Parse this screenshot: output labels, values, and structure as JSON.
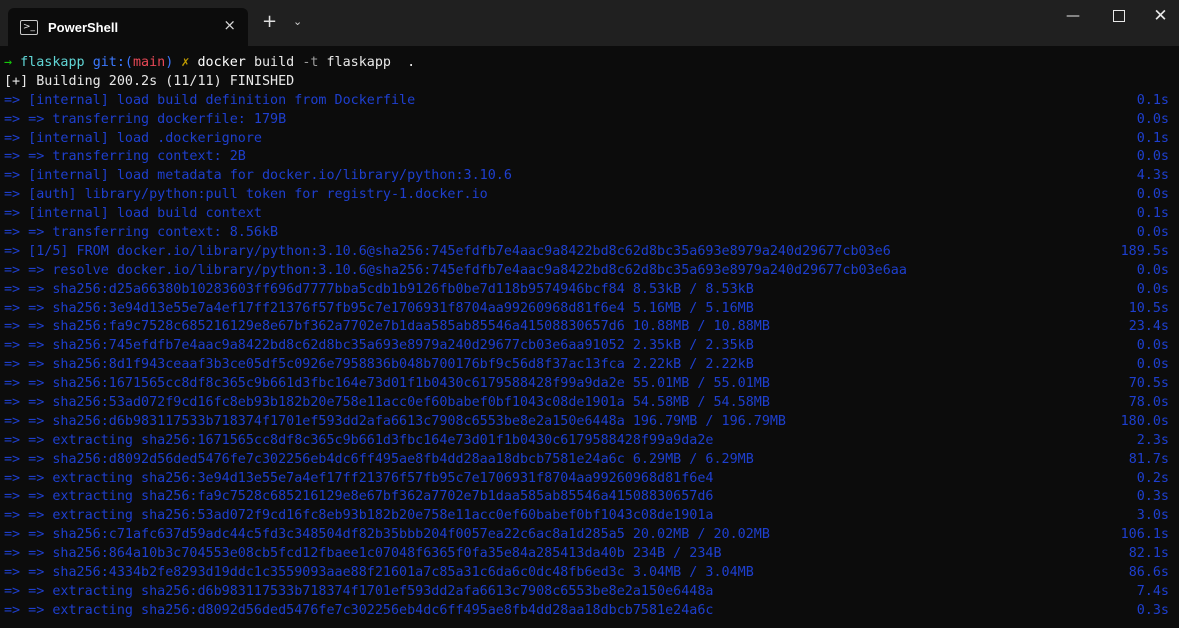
{
  "window": {
    "tab_title": "PowerShell",
    "tab_icon_glyph": ">_",
    "close_tab_glyph": "×",
    "new_tab_glyph": "+",
    "dropdown_glyph": "⌄",
    "minimize_glyph": "—",
    "close_glyph": "✕"
  },
  "prompt": {
    "arrow": "→",
    "dir": "flaskapp",
    "git_label": "git:(",
    "branch": "main",
    "git_close": ")",
    "dirty_mark": "✗",
    "command": "docker",
    "subcommand": "build",
    "flag": "-t",
    "args": "flaskapp  ."
  },
  "build_status": "[+] Building 200.2s (11/11) FINISHED",
  "colors": {
    "background": "#0c0c0c",
    "log_text": "#1e3fcf",
    "prompt_arrow": "#16c60c"
  },
  "log_lines": [
    {
      "text": "=> [internal] load build definition from Dockerfile",
      "time": "0.1s"
    },
    {
      "text": "=> => transferring dockerfile: 179B",
      "time": "0.0s"
    },
    {
      "text": "=> [internal] load .dockerignore",
      "time": "0.1s"
    },
    {
      "text": "=> => transferring context: 2B",
      "time": "0.0s"
    },
    {
      "text": "=> [internal] load metadata for docker.io/library/python:3.10.6",
      "time": "4.3s"
    },
    {
      "text": "=> [auth] library/python:pull token for registry-1.docker.io",
      "time": "0.0s"
    },
    {
      "text": "=> [internal] load build context",
      "time": "0.1s"
    },
    {
      "text": "=> => transferring context: 8.56kB",
      "time": "0.0s"
    },
    {
      "text": "=> [1/5] FROM docker.io/library/python:3.10.6@sha256:745efdfb7e4aac9a8422bd8c62d8bc35a693e8979a240d29677cb03e6",
      "time": "189.5s"
    },
    {
      "text": "=> => resolve docker.io/library/python:3.10.6@sha256:745efdfb7e4aac9a8422bd8c62d8bc35a693e8979a240d29677cb03e6aa",
      "time": "0.0s"
    },
    {
      "text": "=> => sha256:d25a66380b10283603ff696d7777bba5cdb1b9126fb0be7d118b9574946bcf84 8.53kB / 8.53kB",
      "time": "0.0s"
    },
    {
      "text": "=> => sha256:3e94d13e55e7a4ef17ff21376f57fb95c7e1706931f8704aa99260968d81f6e4 5.16MB / 5.16MB",
      "time": "10.5s"
    },
    {
      "text": "=> => sha256:fa9c7528c685216129e8e67bf362a7702e7b1daa585ab85546a41508830657d6 10.88MB / 10.88MB",
      "time": "23.4s"
    },
    {
      "text": "=> => sha256:745efdfb7e4aac9a8422bd8c62d8bc35a693e8979a240d29677cb03e6aa91052 2.35kB / 2.35kB",
      "time": "0.0s"
    },
    {
      "text": "=> => sha256:8d1f943ceaaf3b3ce05df5c0926e7958836b048b700176bf9c56d8f37ac13fca 2.22kB / 2.22kB",
      "time": "0.0s"
    },
    {
      "text": "=> => sha256:1671565cc8df8c365c9b661d3fbc164e73d01f1b0430c6179588428f99a9da2e 55.01MB / 55.01MB",
      "time": "70.5s"
    },
    {
      "text": "=> => sha256:53ad072f9cd16fc8eb93b182b20e758e11acc0ef60babef0bf1043c08de1901a 54.58MB / 54.58MB",
      "time": "78.0s"
    },
    {
      "text": "=> => sha256:d6b983117533b718374f1701ef593dd2afa6613c7908c6553be8e2a150e6448a 196.79MB / 196.79MB",
      "time": "180.0s"
    },
    {
      "text": "=> => extracting sha256:1671565cc8df8c365c9b661d3fbc164e73d01f1b0430c6179588428f99a9da2e",
      "time": "2.3s"
    },
    {
      "text": "=> => sha256:d8092d56ded5476fe7c302256eb4dc6ff495ae8fb4dd28aa18dbcb7581e24a6c 6.29MB / 6.29MB",
      "time": "81.7s"
    },
    {
      "text": "=> => extracting sha256:3e94d13e55e7a4ef17ff21376f57fb95c7e1706931f8704aa99260968d81f6e4",
      "time": "0.2s"
    },
    {
      "text": "=> => extracting sha256:fa9c7528c685216129e8e67bf362a7702e7b1daa585ab85546a41508830657d6",
      "time": "0.3s"
    },
    {
      "text": "=> => extracting sha256:53ad072f9cd16fc8eb93b182b20e758e11acc0ef60babef0bf1043c08de1901a",
      "time": "3.0s"
    },
    {
      "text": "=> => sha256:c71afc637d59adc44c5fd3c348504df82b35bbb204f0057ea22c6ac8a1d285a5 20.02MB / 20.02MB",
      "time": "106.1s"
    },
    {
      "text": "=> => sha256:864a10b3c704553e08cb5fcd12fbaee1c07048f6365f0fa35e84a285413da40b 234B / 234B",
      "time": "82.1s"
    },
    {
      "text": "=> => sha256:4334b2fe8293d19ddc1c3559093aae88f21601a7c85a31c6da6c0dc48fb6ed3c 3.04MB / 3.04MB",
      "time": "86.6s"
    },
    {
      "text": "=> => extracting sha256:d6b983117533b718374f1701ef593dd2afa6613c7908c6553be8e2a150e6448a",
      "time": "7.4s"
    },
    {
      "text": "=> => extracting sha256:d8092d56ded5476fe7c302256eb4dc6ff495ae8fb4dd28aa18dbcb7581e24a6c",
      "time": "0.3s"
    }
  ]
}
